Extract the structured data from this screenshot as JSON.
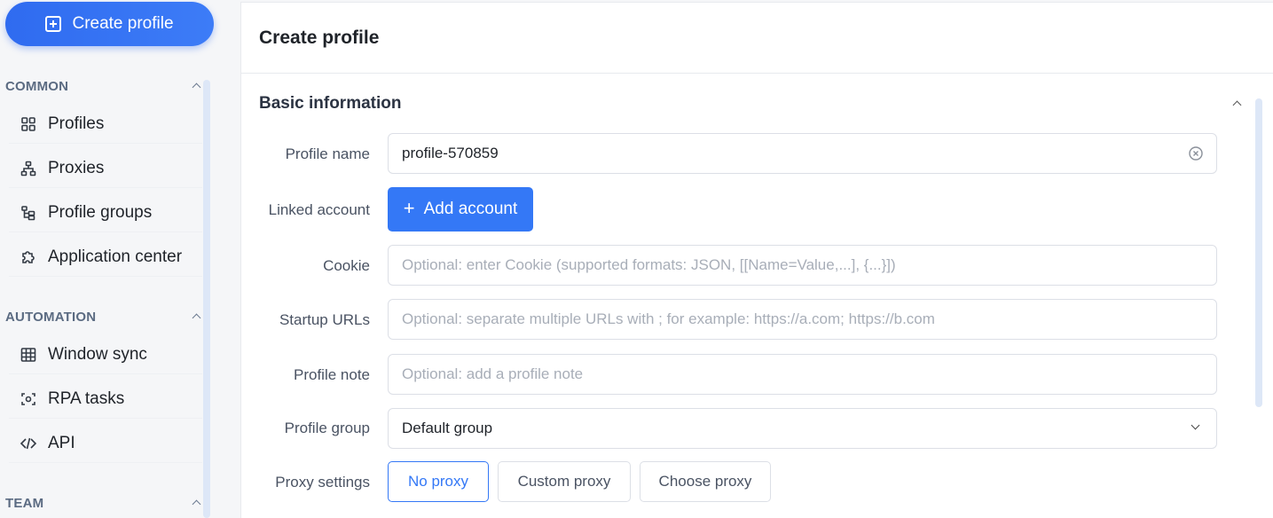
{
  "sidebar": {
    "create_button": "Create profile",
    "sections": [
      {
        "title": "COMMON",
        "items": [
          {
            "label": "Profiles",
            "icon": "grid-icon"
          },
          {
            "label": "Proxies",
            "icon": "network-icon"
          },
          {
            "label": "Profile groups",
            "icon": "tree-icon"
          },
          {
            "label": "Application center",
            "icon": "puzzle-icon"
          }
        ]
      },
      {
        "title": "AUTOMATION",
        "items": [
          {
            "label": "Window sync",
            "icon": "table-icon"
          },
          {
            "label": "RPA tasks",
            "icon": "scan-icon"
          },
          {
            "label": "API",
            "icon": "code-icon"
          }
        ]
      },
      {
        "title": "TEAM",
        "items": []
      }
    ]
  },
  "main": {
    "title": "Create profile",
    "section_title": "Basic information",
    "form": {
      "profile_name": {
        "label": "Profile name",
        "value": "profile-570859"
      },
      "linked_account": {
        "label": "Linked account",
        "button": "Add account"
      },
      "cookie": {
        "label": "Cookie",
        "placeholder": "Optional: enter Cookie (supported formats: JSON, [[Name=Value,...], {...}])"
      },
      "startup_urls": {
        "label": "Startup URLs",
        "placeholder": "Optional: separate multiple URLs with ; for example: https://a.com; https://b.com"
      },
      "profile_note": {
        "label": "Profile note",
        "placeholder": "Optional: add a profile note"
      },
      "profile_group": {
        "label": "Profile group",
        "value": "Default group"
      },
      "proxy_settings": {
        "label": "Proxy settings",
        "options": [
          "No proxy",
          "Custom proxy",
          "Choose proxy"
        ],
        "selected": "No proxy"
      }
    }
  },
  "colors": {
    "accent": "#3478f6",
    "sidebar_bg": "#f5f6f8"
  }
}
